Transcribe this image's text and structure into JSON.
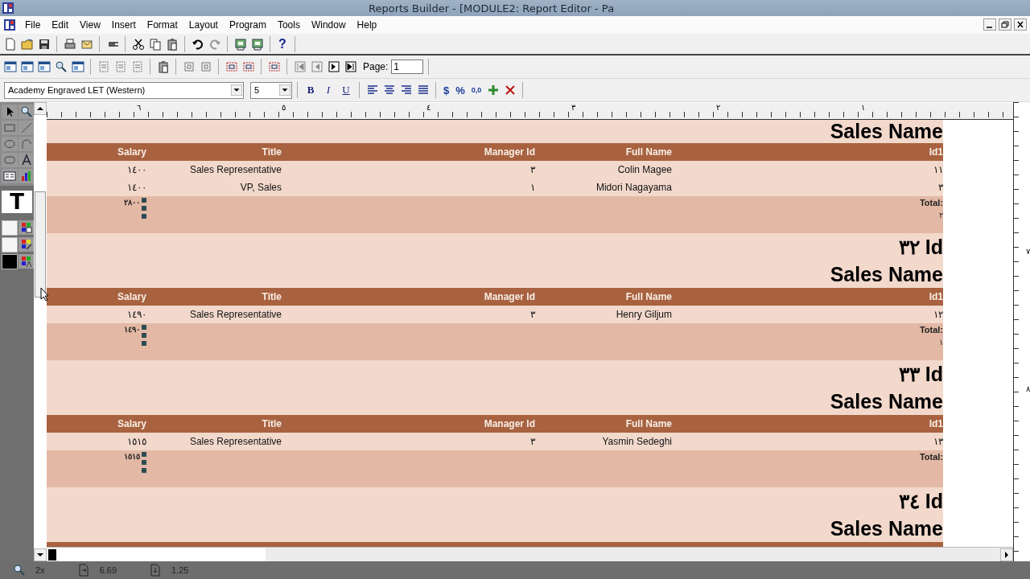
{
  "window": {
    "title": "Reports Builder - [MODULE2: Report Editor - Pa"
  },
  "menu": [
    {
      "label": "File"
    },
    {
      "label": "Edit"
    },
    {
      "label": "View"
    },
    {
      "label": "Insert"
    },
    {
      "label": "Format"
    },
    {
      "label": "Layout"
    },
    {
      "label": "Program"
    },
    {
      "label": "Tools"
    },
    {
      "label": "Window"
    },
    {
      "label": "Help"
    }
  ],
  "help_button": "?",
  "page_field": {
    "label": "Page:",
    "value": "1"
  },
  "font_field": {
    "value": "Academy Engraved LET (Western)"
  },
  "size_field": {
    "value": "5"
  },
  "style_buttons": [
    "B",
    "I",
    "U"
  ],
  "number_buttons": [
    "$",
    "%",
    "0,0"
  ],
  "text_tool": "T",
  "ruler": {
    "labels": [
      "١",
      "٢",
      "٣",
      "٤",
      "٥",
      "٦"
    ]
  },
  "vertical_ruler": {
    "labels": [
      "٧",
      "٨"
    ]
  },
  "report": {
    "groups": [
      {
        "heading": "Sales Name",
        "columns": [
          "Salary",
          "Title",
          "Manager Id",
          "Full Name",
          "Id1"
        ],
        "rows": [
          [
            "١٤٠٠",
            "Sales Representative",
            "٣",
            "Colin Magee",
            "١١"
          ],
          [
            "١٤٠٠",
            "VP, Sales",
            "١",
            "Midori Nagayama",
            "٣"
          ]
        ],
        "total_label": "Total:",
        "total_count": "٢",
        "salary_total": "٢٨٠٠"
      },
      {
        "id_label": "٣٢ Id",
        "heading": "Sales Name",
        "columns": [
          "Salary",
          "Title",
          "Manager Id",
          "Full Name",
          "Id1"
        ],
        "rows": [
          [
            "١٤٩٠",
            "Sales Representative",
            "٣",
            "Henry Giljum",
            "١٢"
          ]
        ],
        "total_label": "Total:",
        "total_count": "١",
        "salary_total": "١٤٩٠"
      },
      {
        "id_label": "٣٣ Id",
        "heading": "Sales Name",
        "columns": [
          "Salary",
          "Title",
          "Manager Id",
          "Full Name",
          "Id1"
        ],
        "rows": [
          [
            "١٥١٥",
            "Sales Representative",
            "٣",
            "Yasmin Sedeghi",
            "١٣"
          ]
        ],
        "total_label": "Total:",
        "salary_total": "١٥١٥"
      },
      {
        "id_label": "٣٤ Id",
        "heading": "Sales Name"
      }
    ]
  },
  "status_bar": [
    {
      "kind": "zoom",
      "text": "2x"
    },
    {
      "kind": "page",
      "text": "6.69"
    },
    {
      "kind": "page2",
      "text": "1.25"
    }
  ]
}
